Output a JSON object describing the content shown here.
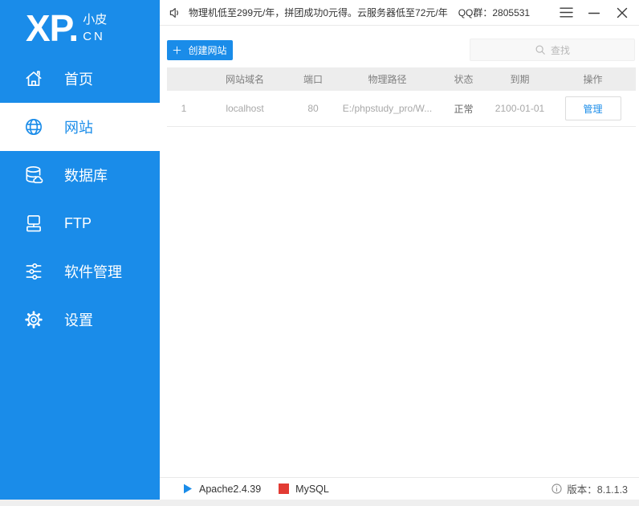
{
  "colors": {
    "brand_blue": "#1a8ce9",
    "active_item_bg": "#ffffff",
    "mysql_red": "#e23b33",
    "table_header_bg": "#ededed"
  },
  "logo": {
    "main": "XP.",
    "sub_top": "小皮",
    "sub_bottom": "CN"
  },
  "sidebar": {
    "items": [
      {
        "label": "首页"
      },
      {
        "label": "网站"
      },
      {
        "label": "数据库"
      },
      {
        "label": "FTP"
      },
      {
        "label": "软件管理"
      },
      {
        "label": "设置"
      }
    ]
  },
  "topbar": {
    "announcement": "物理机低至299元/年，拼团成功0元得。云服务器低至72元/年",
    "qq_group": "QQ群：2805531"
  },
  "toolbar": {
    "create_button": "创建网站",
    "search_placeholder": "查找"
  },
  "table": {
    "headers": [
      "",
      "网站域名",
      "端口",
      "物理路径",
      "状态",
      "到期",
      "操作"
    ],
    "rows": [
      {
        "index": "1",
        "domain": "localhost",
        "port": "80",
        "path": "E:/phpstudy_pro/W...",
        "status": "正常",
        "expire": "2100-01-01",
        "action": "管理"
      }
    ]
  },
  "statusbar": {
    "apache": "Apache2.4.39",
    "mysql": "MySQL",
    "version": "版本：8.1.1.3"
  }
}
